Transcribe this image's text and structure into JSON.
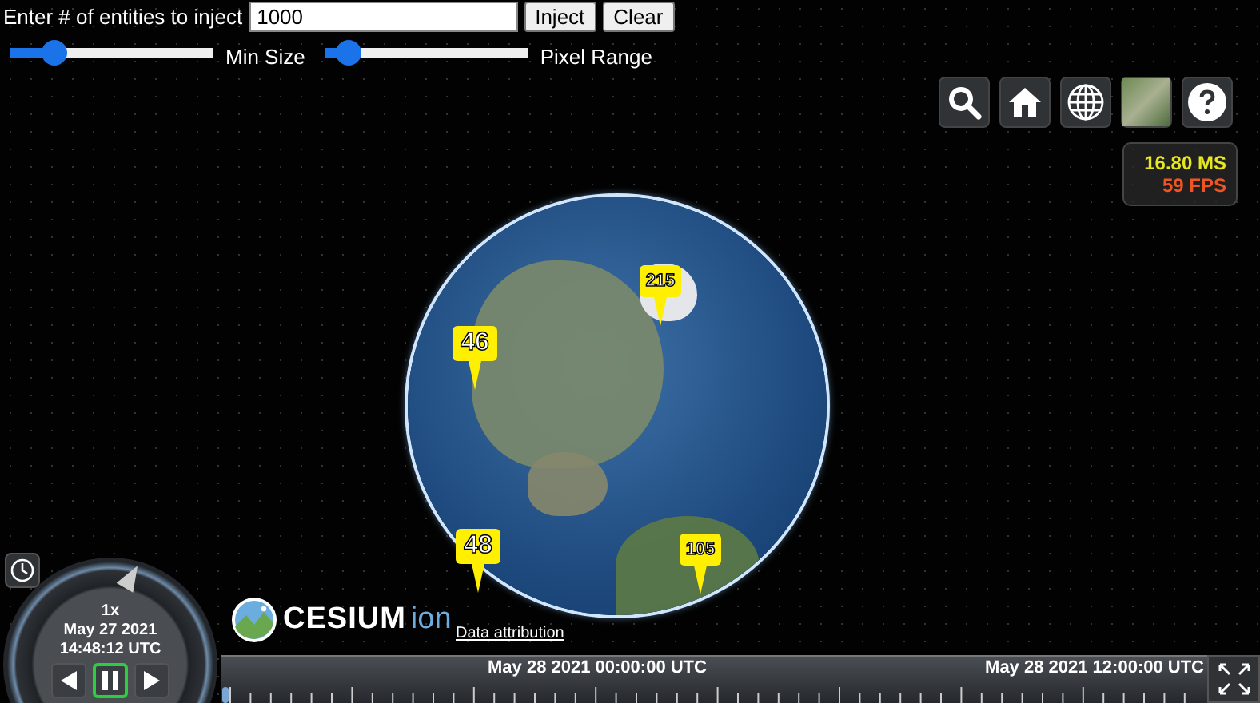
{
  "controls": {
    "label": "Enter # of entities to inject",
    "input": {
      "value": "1000"
    },
    "buttons": [
      "Inject",
      "Clear"
    ],
    "sliders": [
      {
        "label": "Min Size",
        "level": 0.22
      },
      {
        "label": "Pixel Range",
        "level": 0.12
      }
    ]
  },
  "clusters": [
    {
      "count": "215"
    },
    {
      "count": "46"
    },
    {
      "count": "48"
    },
    {
      "count": "105"
    }
  ],
  "performance": {
    "frame_time": "16.80 MS",
    "fps": "59 FPS"
  },
  "logo": {
    "name": "CESIUM",
    "suffix": "ion"
  },
  "attribution": "Data attribution",
  "animation": {
    "speed": "1x",
    "date": "May 27 2021",
    "time": "14:48:12 UTC",
    "buttons": [
      {
        "kind": "reverse",
        "selected": false
      },
      {
        "kind": "pause",
        "selected": true
      },
      {
        "kind": "play",
        "selected": false
      }
    ]
  },
  "timeline": {
    "labels": [
      "May 28 2021 00:00:00 UTC",
      "May 28 2021 12:00:00 UTC"
    ]
  }
}
